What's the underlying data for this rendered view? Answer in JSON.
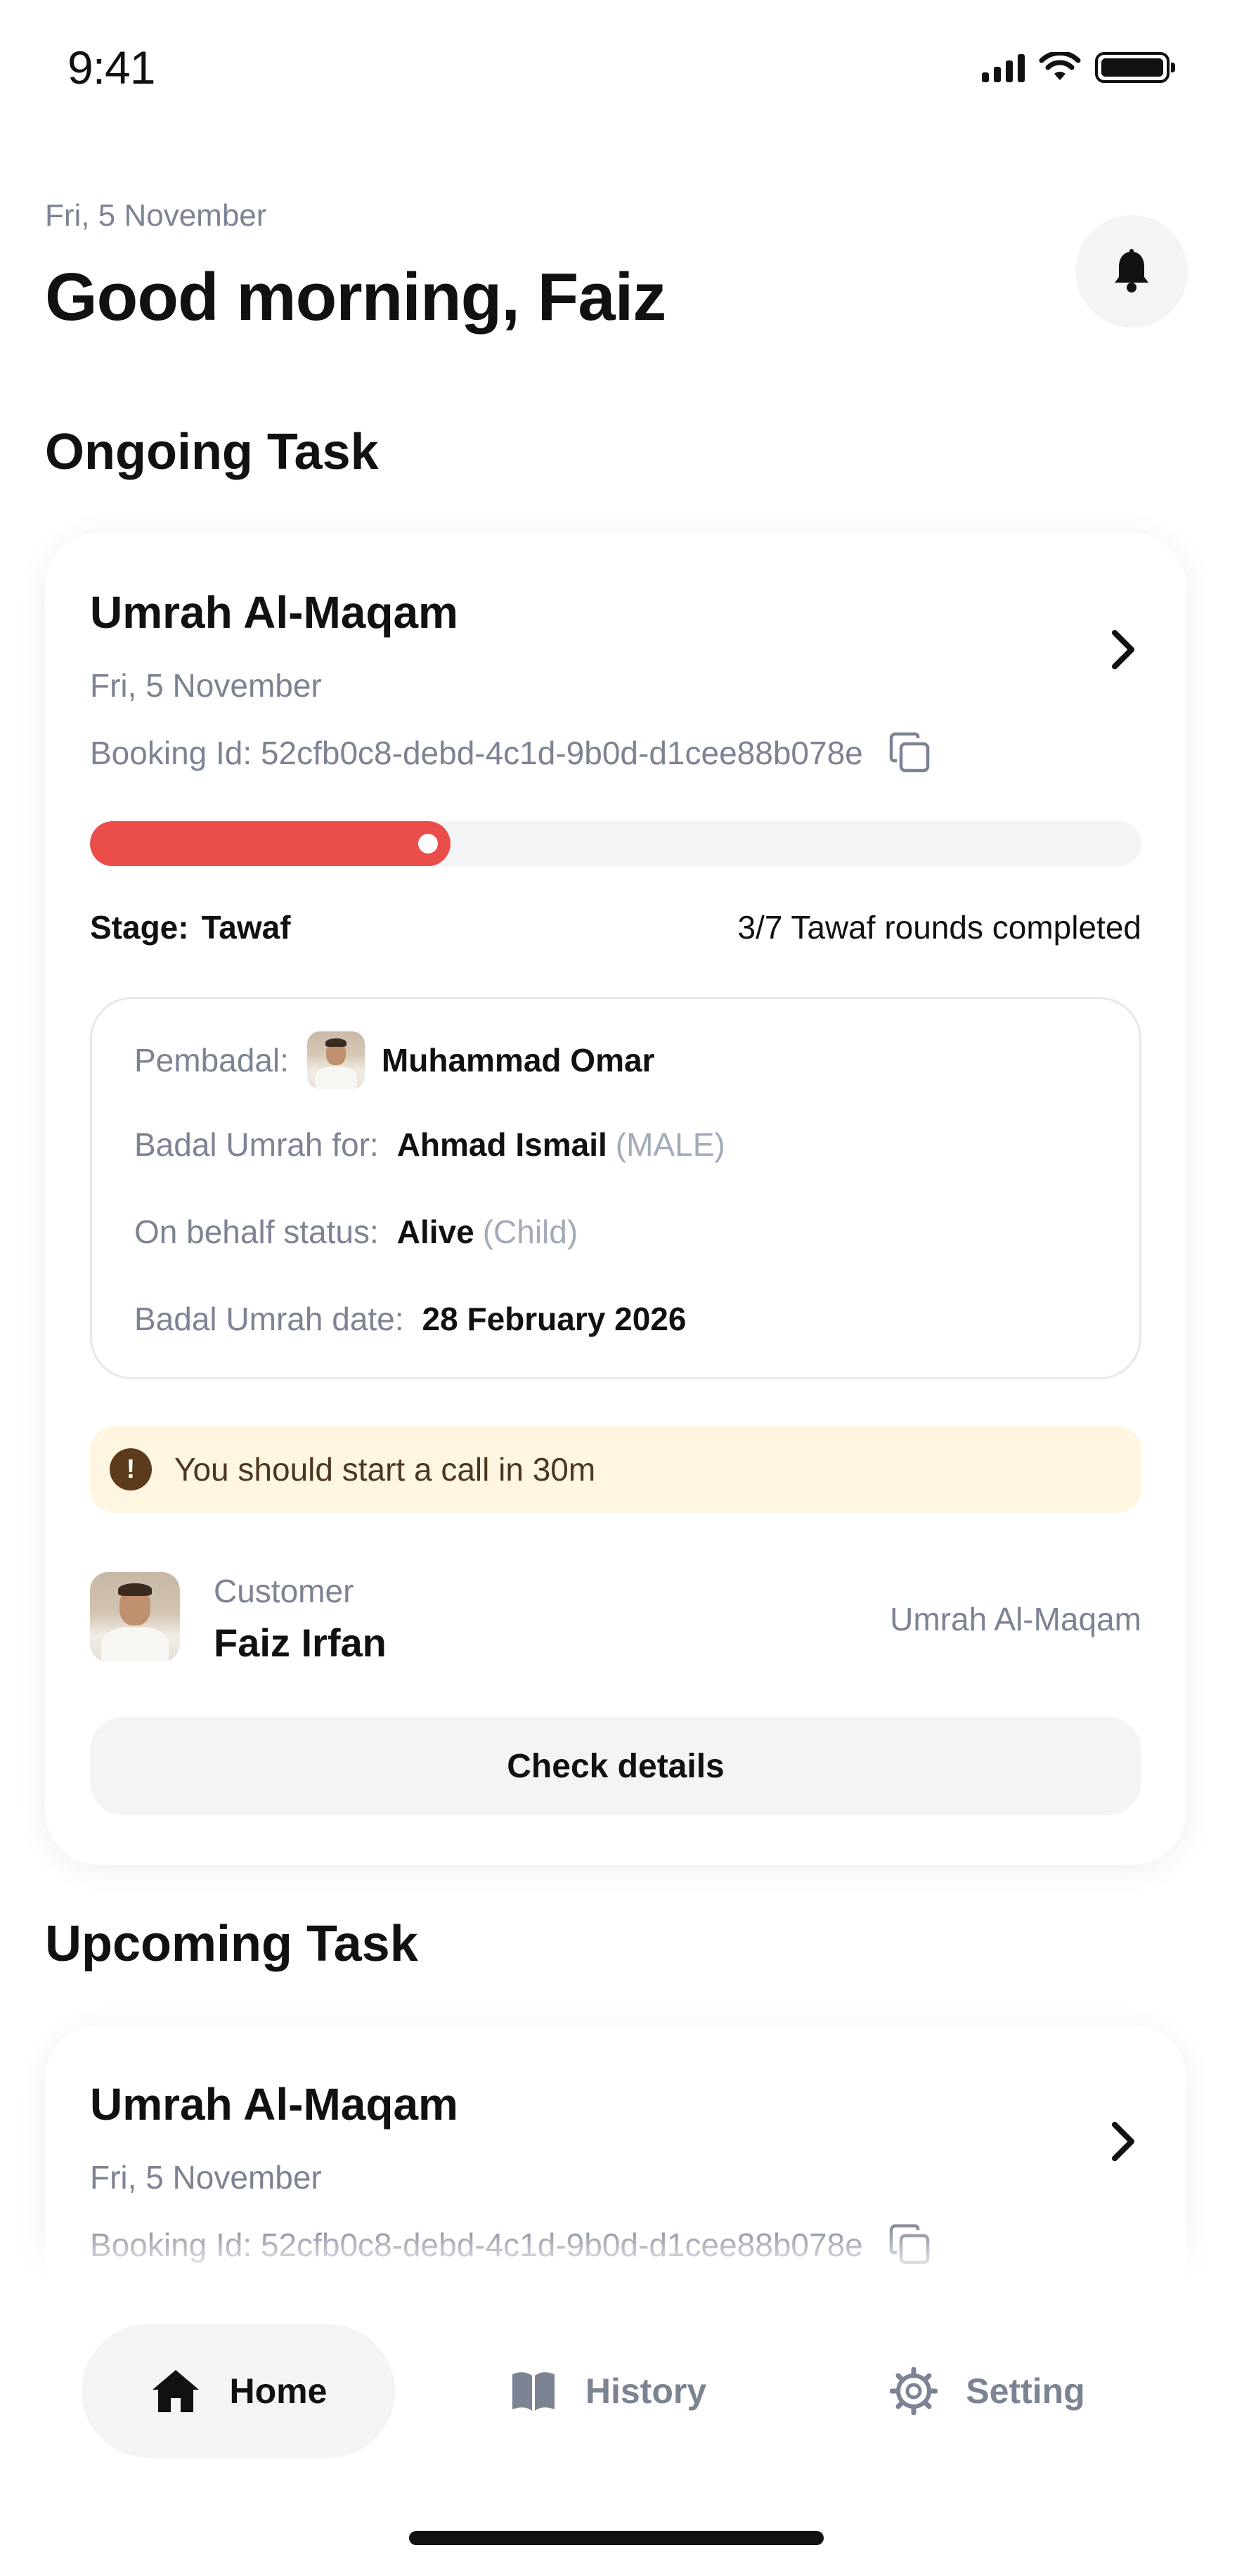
{
  "status_bar": {
    "time": "9:41"
  },
  "header": {
    "date": "Fri, 5 November",
    "greeting": "Good morning, Faiz"
  },
  "ongoing": {
    "section_title": "Ongoing Task",
    "title": "Umrah Al-Maqam",
    "date": "Fri, 5 November",
    "booking_id": "Booking Id: 52cfb0c8-debd-4c1d-9b0d-d1cee88b078e",
    "progress_fraction": 0.343,
    "stage_label": "Stage:",
    "stage_value": "Tawaf",
    "rounds_text": "3/7 Tawaf rounds completed",
    "details": {
      "pembadal_label": "Pembadal:",
      "pembadal_name": "Muhammad Omar",
      "for_label": "Badal Umrah for:",
      "for_name": "Ahmad Ismail",
      "for_gender": "(MALE)",
      "status_label": "On behalf status:",
      "status_value": "Alive",
      "status_relation": "(Child)",
      "date_label": "Badal Umrah date:",
      "date_value": "28 February 2026"
    },
    "alert": {
      "icon": "!",
      "text": "You should start a call in 30m"
    },
    "customer": {
      "label": "Customer",
      "name": "Faiz Irfan",
      "package": "Umrah Al-Maqam"
    },
    "check_details_label": "Check details"
  },
  "upcoming": {
    "section_title": "Upcoming Task",
    "title": "Umrah Al-Maqam",
    "date": "Fri, 5 November",
    "booking_id": "Booking Id: 52cfb0c8-debd-4c1d-9b0d-d1cee88b078e"
  },
  "nav": {
    "home": "Home",
    "history": "History",
    "setting": "Setting"
  },
  "colors": {
    "accent_red": "#eb4d4b",
    "alert_bg": "#fef6e1",
    "muted_text": "#7c8393"
  }
}
